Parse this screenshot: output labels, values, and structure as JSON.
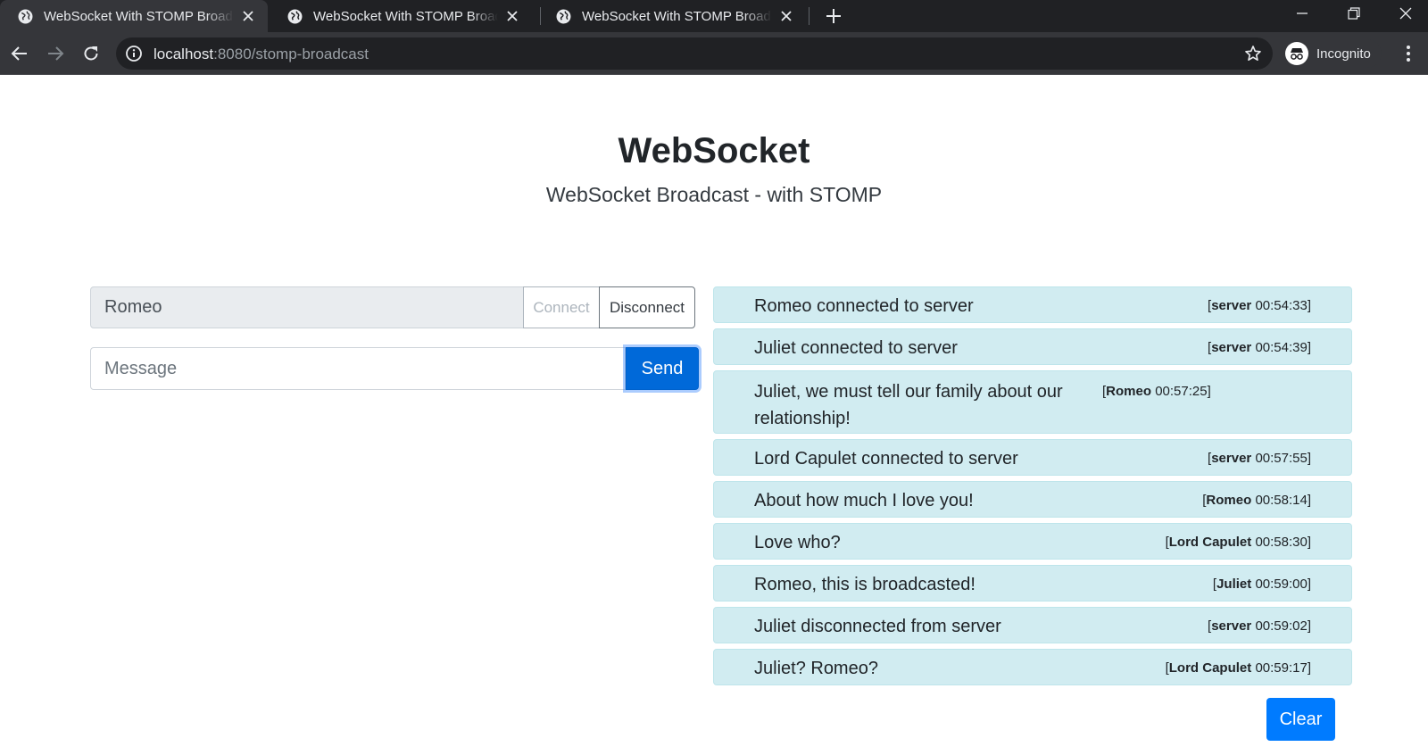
{
  "browser": {
    "tabs": [
      {
        "title": "WebSocket With STOMP Broadcast"
      },
      {
        "title": "WebSocket With STOMP Broadcast"
      },
      {
        "title": "WebSocket With STOMP Broadcast"
      }
    ],
    "url_host": "localhost",
    "url_path": ":8080/stomp-broadcast",
    "profile_label": "Incognito"
  },
  "page": {
    "heading": "WebSocket",
    "lead": "WebSocket Broadcast - with STOMP",
    "name_value": "Romeo",
    "connect_label": "Connect",
    "disconnect_label": "Disconnect",
    "message_placeholder": "Message",
    "send_label": "Send",
    "clear_label": "Clear"
  },
  "messages": [
    {
      "text": "Romeo connected to server",
      "sender": "server",
      "time": "00:54:33"
    },
    {
      "text": "Juliet connected to server",
      "sender": "server",
      "time": "00:54:39"
    },
    {
      "text": "Juliet, we must tell our family about our relationship!",
      "sender": "Romeo",
      "time": "00:57:25"
    },
    {
      "text": "Lord Capulet connected to server",
      "sender": "server",
      "time": "00:57:55"
    },
    {
      "text": "About how much I love you!",
      "sender": "Romeo",
      "time": "00:58:14"
    },
    {
      "text": "Love who?",
      "sender": "Lord Capulet",
      "time": "00:58:30"
    },
    {
      "text": "Romeo, this is broadcasted!",
      "sender": "Juliet",
      "time": "00:59:00"
    },
    {
      "text": "Juliet disconnected from server",
      "sender": "server",
      "time": "00:59:02"
    },
    {
      "text": "Juliet? Romeo?",
      "sender": "Lord Capulet",
      "time": "00:59:17"
    }
  ]
}
